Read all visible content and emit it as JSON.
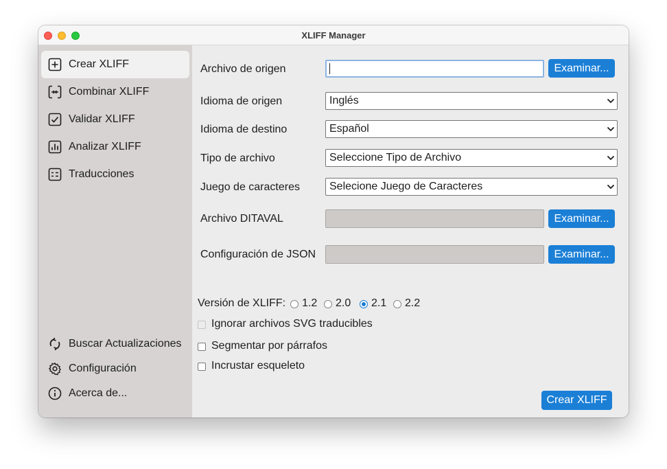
{
  "window": {
    "title": "XLIFF Manager"
  },
  "sidebar": {
    "items": [
      {
        "label": "Crear XLIFF",
        "icon": "plus-square-icon",
        "active": true
      },
      {
        "label": "Combinar XLIFF",
        "icon": "merge-icon",
        "active": false
      },
      {
        "label": "Validar XLIFF",
        "icon": "check-square-icon",
        "active": false
      },
      {
        "label": "Analizar XLIFF",
        "icon": "bar-chart-icon",
        "active": false
      },
      {
        "label": "Traducciones",
        "icon": "list-icon",
        "active": false
      }
    ],
    "bottom_items": [
      {
        "label": "Buscar Actualizaciones",
        "icon": "refresh-icon"
      },
      {
        "label": "Configuración",
        "icon": "gear-icon"
      },
      {
        "label": "Acerca de...",
        "icon": "info-icon"
      }
    ]
  },
  "form": {
    "source_file": {
      "label": "Archivo de origen",
      "value": "",
      "button": "Examinar..."
    },
    "source_language": {
      "label": "Idioma de origen",
      "selected": "Inglés"
    },
    "target_language": {
      "label": "Idioma de destino",
      "selected": "Español"
    },
    "file_type": {
      "label": "Tipo de archivo",
      "selected": "Seleccione Tipo de Archivo"
    },
    "charset": {
      "label": "Juego de caracteres",
      "selected": "Selecione Juego de Caracteres"
    },
    "ditaval": {
      "label": "Archivo DITAVAL",
      "value": "",
      "button": "Examinar..."
    },
    "json_config": {
      "label": "Configuración de JSON",
      "value": "",
      "button": "Examinar..."
    },
    "version": {
      "label": "Versión de XLIFF:",
      "options": [
        "1.2",
        "2.0",
        "2.1",
        "2.2"
      ],
      "selected": "2.1"
    },
    "checkboxes": [
      {
        "label": "Ignorar archivos SVG traducibles",
        "checked": false,
        "disabled": true
      },
      {
        "label": "Segmentar por párrafos",
        "checked": false,
        "disabled": false
      },
      {
        "label": "Incrustar esqueleto",
        "checked": false,
        "disabled": false
      }
    ],
    "submit_label": "Crear XLIFF"
  },
  "colors": {
    "accent": "#1b7fd6",
    "sidebar_bg": "#d6d3d2",
    "sidebar_active": "#f2f1f1",
    "content_bg": "#ececec",
    "traffic_close": "#ff5f57",
    "traffic_minimize": "#febc2e",
    "traffic_maximize": "#28c840"
  }
}
